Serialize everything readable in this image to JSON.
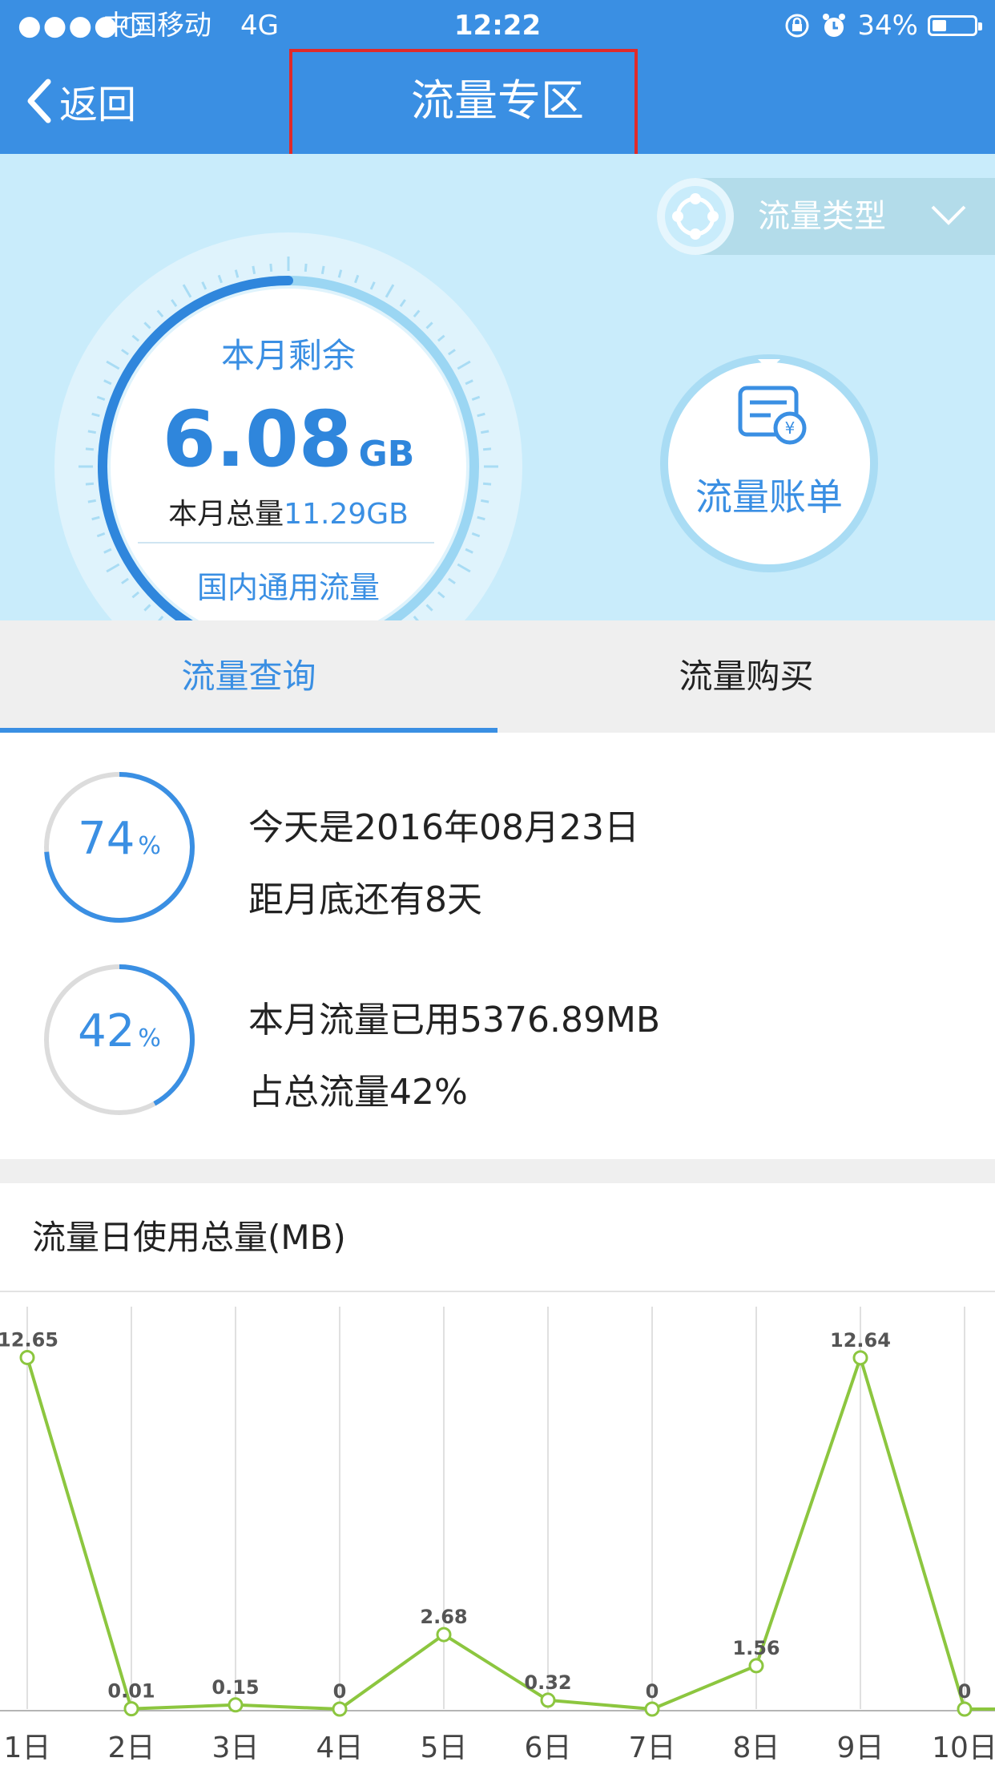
{
  "status_bar": {
    "signal": "●●●●○",
    "carrier": "中国移动",
    "network": "4G",
    "time": "12:22",
    "battery": "34%",
    "battery_level": 0.34
  },
  "nav": {
    "back_label": "返回",
    "title": "流量专区"
  },
  "hero": {
    "type_selector_label": "流量类型",
    "remaining_label": "本月剩余",
    "remaining_value": "6.08",
    "remaining_unit": "GB",
    "total_label": "本月总量",
    "total_value": "11.29GB",
    "scope_label": "国内通用流量",
    "remaining_fraction": 0.54,
    "bill_label": "流量账单"
  },
  "tabs": [
    {
      "label": "流量查询",
      "active": true
    },
    {
      "label": "流量购买",
      "active": false
    }
  ],
  "summary": {
    "month_progress": {
      "value": "74",
      "unit": "%",
      "fraction": 0.74
    },
    "date_line": "今天是2016年08月23日",
    "days_left_line": "距月底还有8天",
    "usage_progress": {
      "value": "42",
      "unit": "%",
      "fraction": 0.42
    },
    "used_line": "本月流量已用5376.89MB",
    "share_line": "占总流量42%"
  },
  "colors": {
    "primary": "#3a8fe3",
    "hero_bg": "#c9ecfb",
    "line": "#8cc63f",
    "highlight_frame": "#e02a2a"
  },
  "chart_title": "流量日使用总量(MB)",
  "chart_data": {
    "type": "line",
    "categories": [
      "1日",
      "2日",
      "3日",
      "4日",
      "5日",
      "6日",
      "7日",
      "8日",
      "9日",
      "10日"
    ],
    "values": [
      12.65,
      0.01,
      0.15,
      0,
      2.68,
      0.32,
      0,
      1.56,
      12.64,
      0
    ],
    "labels": [
      "12.65",
      "0.01",
      "0.15",
      "0",
      "2.68",
      "0.32",
      "0",
      "1.56",
      "12.64",
      "0"
    ],
    "ylim": [
      0,
      15
    ],
    "grid": "vertical"
  }
}
